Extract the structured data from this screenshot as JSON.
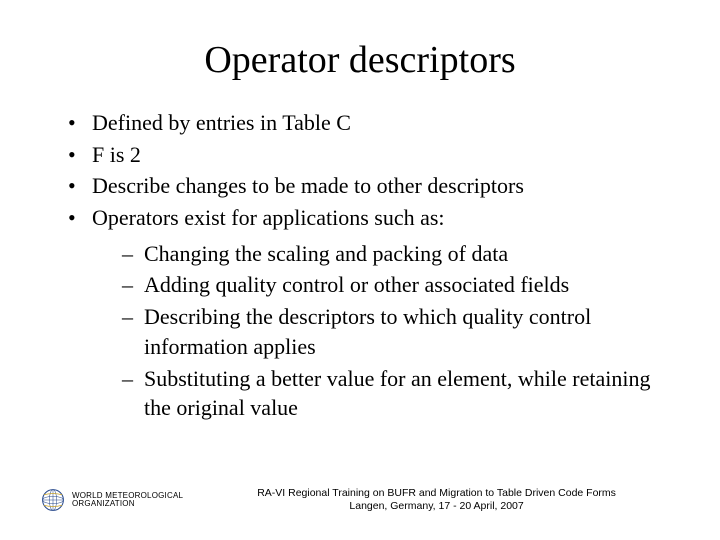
{
  "title": "Operator descriptors",
  "bullets": [
    "Defined by entries in Table C",
    "F is 2",
    "Describe changes to be made to other descriptors",
    "Operators exist for applications such as:"
  ],
  "sub_bullets": [
    "Changing the scaling and packing of data",
    "Adding quality control or other associated fields",
    "Describing the descriptors to which quality control information applies",
    "Substituting a better value for an element, while retaining the original value"
  ],
  "footer": {
    "org_line1": "WORLD METEOROLOGICAL",
    "org_line2": "ORGANIZATION",
    "center_line1": "RA-VI Regional Training on BUFR and Migration to Table Driven Code Forms",
    "center_line2": "Langen, Germany, 17 - 20 April, 2007"
  }
}
